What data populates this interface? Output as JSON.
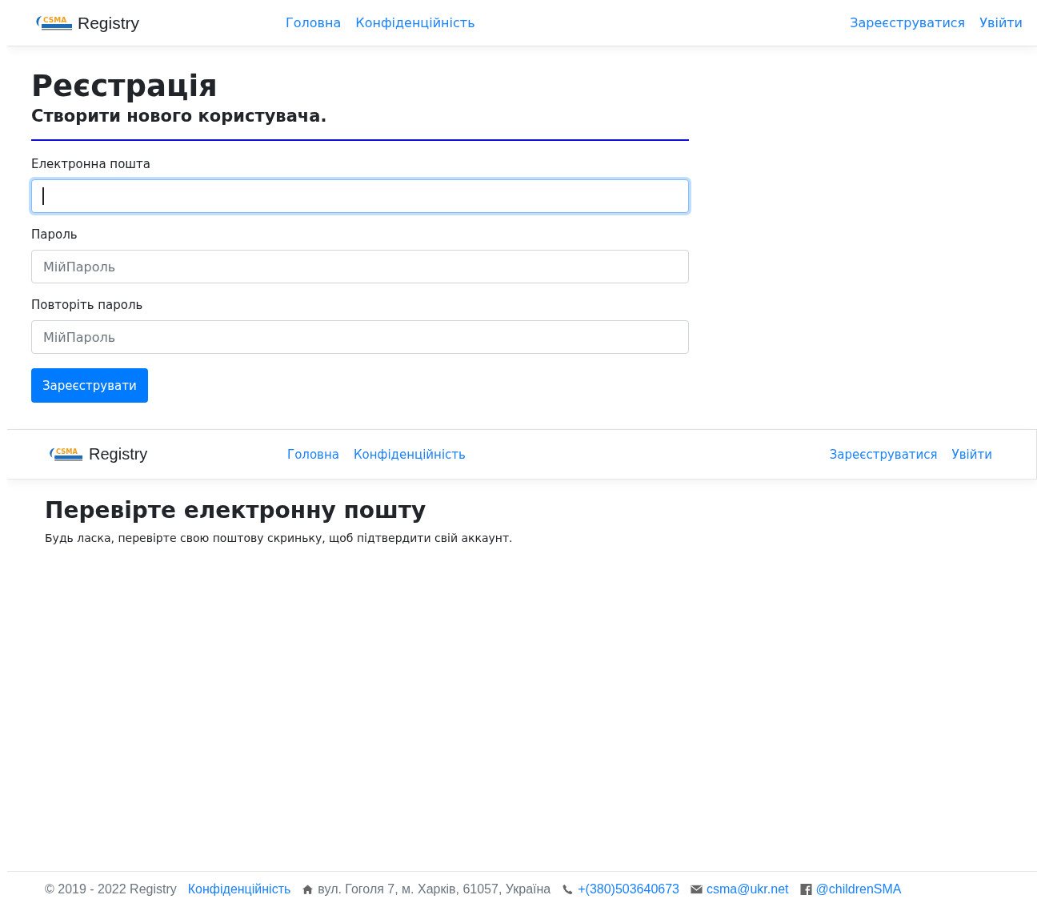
{
  "navbar": {
    "logo_text": "CSMA",
    "brand": "Registry",
    "links": [
      {
        "label": "Головна"
      },
      {
        "label": "Конфіденційність"
      }
    ],
    "account_links": [
      {
        "label": "Зареєструватися"
      },
      {
        "label": "Увійти"
      }
    ]
  },
  "register": {
    "title": "Реєстрація",
    "subtitle": "Створити нового користувача.",
    "fields": [
      {
        "label": "Електронна пошта",
        "focused": true
      },
      {
        "label": "Пароль",
        "placeholder": "МійПароль",
        "focused": false
      },
      {
        "label": "Повторіть пароль",
        "placeholder": "МійПароль",
        "focused": false
      }
    ],
    "submit": "Зареєструвати"
  },
  "confirm_page": {
    "navbar": {
      "logo_text": "CSMA",
      "brand": "Registry",
      "links": [
        {
          "label": "Головна"
        },
        {
          "label": "Конфіденційність"
        }
      ],
      "account_links": [
        {
          "label": "Зареєструватися"
        },
        {
          "label": "Увійти"
        }
      ]
    },
    "title": "Перевірте електронну пошту",
    "message": "Будь ласка, перевірте свою поштову скриньку, щоб підтвердити свій аккаунт."
  },
  "footer": {
    "copyright": "© 2019 - 2022 Registry",
    "privacy_link": "Конфіденційність",
    "contacts": [
      {
        "kind": "address",
        "text": "вул. Гоголя 7, м. Харків, 61057, Україна"
      },
      {
        "kind": "phone",
        "text": "+(380)503640673"
      },
      {
        "kind": "email",
        "text": "csma@ukr.net"
      },
      {
        "kind": "facebook",
        "text": "@childrenSMA"
      }
    ]
  }
}
